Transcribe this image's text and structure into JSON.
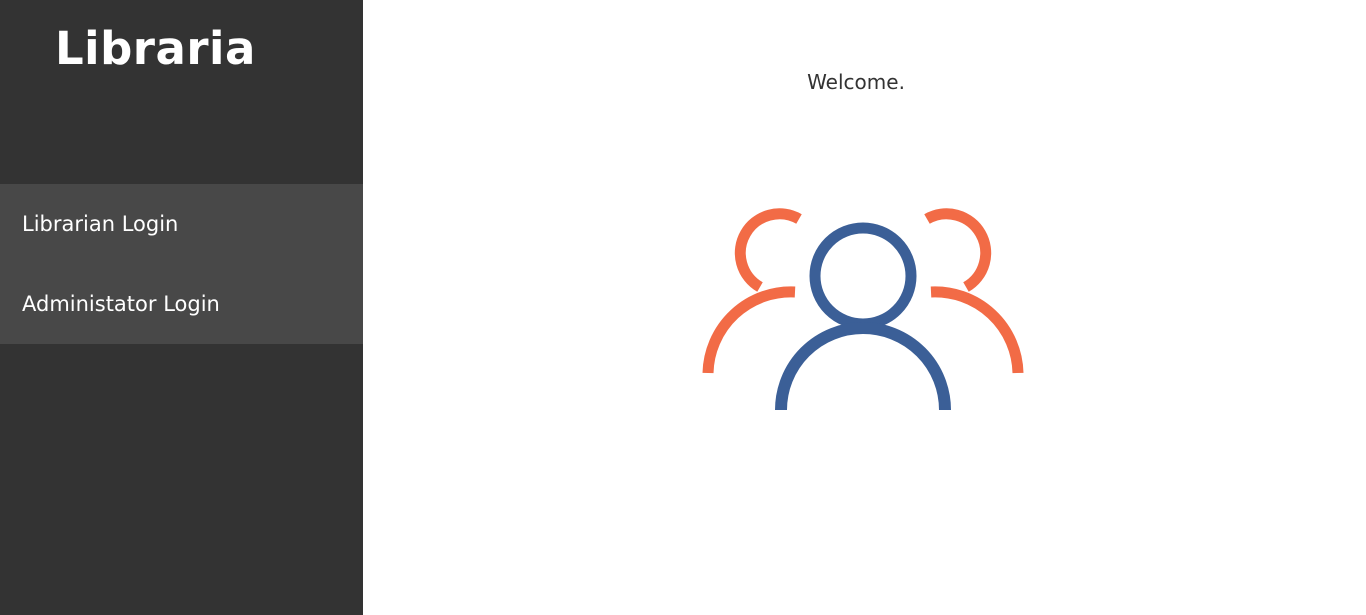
{
  "app": {
    "title": "Libraria"
  },
  "sidebar": {
    "items": [
      {
        "label": "Librarian Login"
      },
      {
        "label": "Administator Login"
      }
    ]
  },
  "main": {
    "welcome": "Welcome.",
    "illustration": {
      "icon": "users-group-icon",
      "colors": {
        "side_people": "#f26b46",
        "center_person": "#3b5f97"
      }
    }
  },
  "colors": {
    "sidebar_bg": "#333333",
    "nav_bg": "#484848",
    "main_bg": "#ffffff"
  }
}
